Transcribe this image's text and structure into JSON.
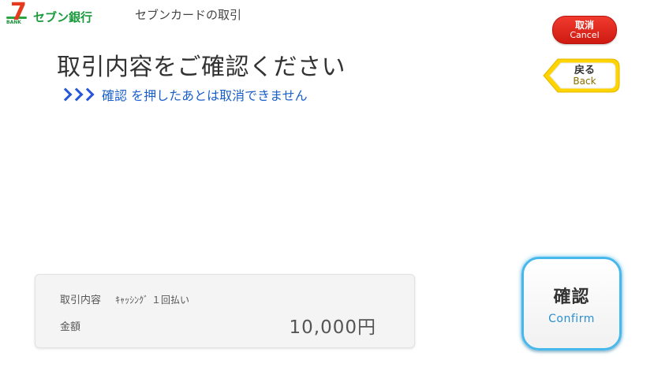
{
  "header": {
    "logo_text": "セブン銀行",
    "logo_mark_text": "7",
    "logo_mark_subtext": "BANK",
    "title": "セブンカードの取引"
  },
  "main": {
    "title": "取引内容をご確認ください",
    "instruction": "確認 を押したあとは取消できません"
  },
  "buttons": {
    "cancel": {
      "jp": "取消",
      "en": "Cancel"
    },
    "back": {
      "jp": "戻る",
      "en": "Back"
    },
    "confirm": {
      "jp": "確認",
      "en": "Confirm"
    }
  },
  "summary": {
    "transaction_label": "取引内容",
    "transaction_value": "ｷｬｯｼﾝｸﾞ １回払い",
    "amount_label": "金額",
    "amount_value": "10,000円"
  },
  "colors": {
    "brand_green": "#1a9a3d",
    "brand_red": "#e63a1e",
    "cancel_red": "#e02a20",
    "back_yellow": "#ffd400",
    "confirm_blue": "#47b8ec",
    "instruction_blue": "#1a5fc8"
  },
  "icons": {
    "instruction": "triple-chevron-right-icon",
    "back": "left-arrow-shape-icon"
  }
}
